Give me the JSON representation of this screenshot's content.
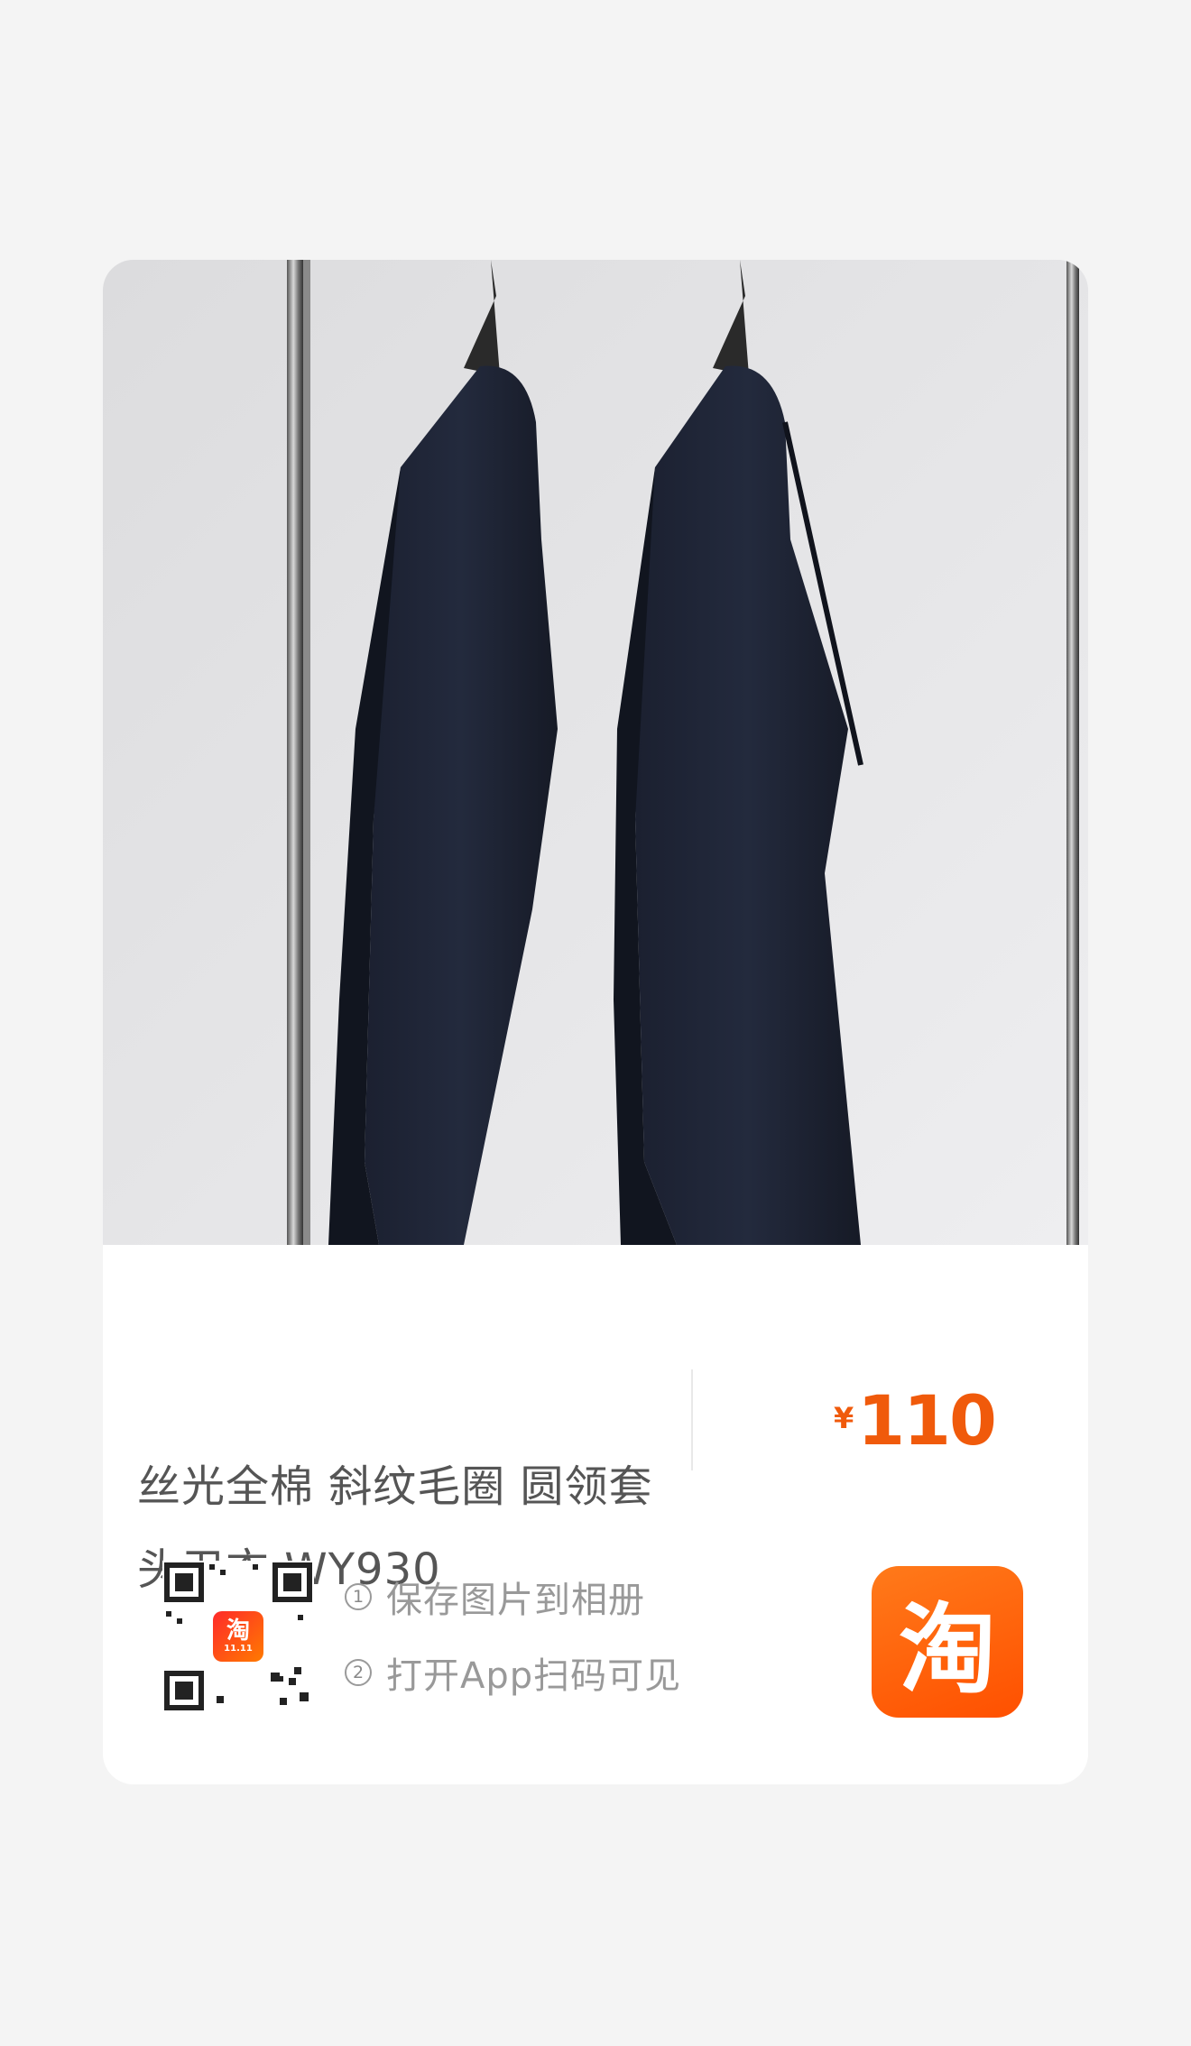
{
  "product": {
    "title_line1": "丝光全棉 斜纹毛圈 圆领套",
    "title_line2": "头卫衣 WY930",
    "currency": "¥",
    "price": "110",
    "image_alt": "两件深蓝色圆领卫衣挂在衣架上"
  },
  "steps": [
    {
      "num": "①",
      "text": "保存图片到相册"
    },
    {
      "num": "②",
      "text": "打开App扫码可见"
    }
  ],
  "qr": {
    "badge_char": "淘",
    "badge_sub": "11.11"
  },
  "app_logo": {
    "char": "淘"
  },
  "colors": {
    "price": "#f05a0b",
    "brand": "#ff5000",
    "background": "#f4f4f4"
  }
}
